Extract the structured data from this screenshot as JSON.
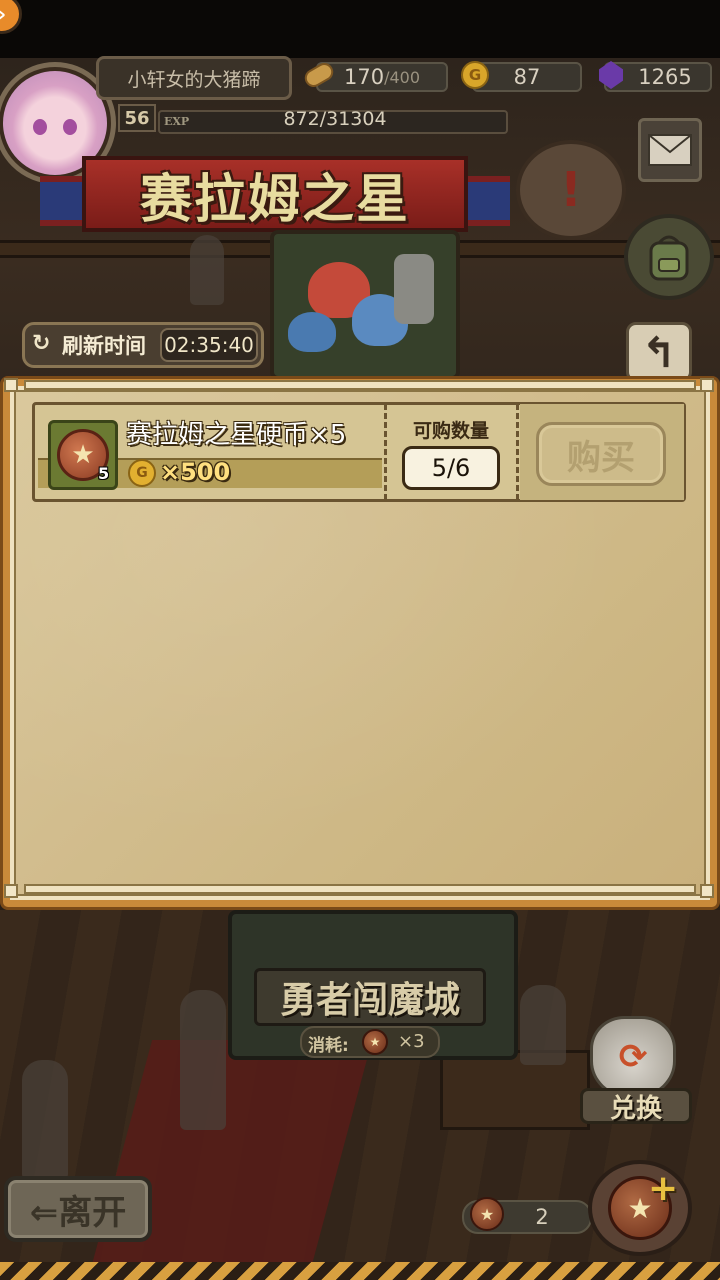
{
  "player": {
    "name": "小轩女的大猪蹄",
    "level": "56",
    "exp_label": "EXP",
    "exp_text": "872/31304"
  },
  "resources": {
    "stamina": "170",
    "stamina_max": "/400",
    "gold": "87",
    "gems": "1265",
    "gold_icon_glyph": "G"
  },
  "banner": {
    "title": "赛拉姆之星"
  },
  "refresh": {
    "label": "刷新时间",
    "time": "02:35:40",
    "icon": "refresh-icon"
  },
  "shop": {
    "items": [
      {
        "name": "赛拉姆之星硬币×5",
        "count_badge": "5",
        "price": "×500",
        "price_currency_glyph": "G",
        "qty_label": "可购数量",
        "qty": "5/6",
        "buy_label": "购买"
      }
    ]
  },
  "dungeon": {
    "title": "勇者闯魔城",
    "cost_label": "消耗:",
    "cost_qty": "×3"
  },
  "exchange": {
    "label": "兑换"
  },
  "leave": {
    "label": "⇐离开"
  },
  "coins": {
    "count": "2"
  },
  "colors": {
    "panel_frame": "#c98a3a",
    "parchment": "#d2bd8e",
    "gold_text": "#ffe080",
    "banner_red": "#a83028"
  }
}
